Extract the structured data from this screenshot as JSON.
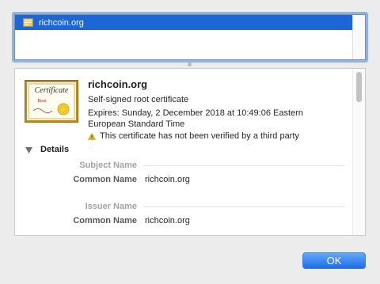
{
  "certificate_list": {
    "selected_item": "richcoin.org"
  },
  "summary": {
    "name": "richcoin.org",
    "type": "Self-signed root certificate",
    "expires": "Expires: Sunday, 2 December 2018 at 10:49:06 Eastern European Standard Time",
    "warning": "This certificate has not been verified by a third party",
    "certificate_image_text": "Certificate Root"
  },
  "details": {
    "label": "Details",
    "subject": {
      "header": "Subject Name",
      "common_name_label": "Common Name",
      "common_name_value": "richcoin.org"
    },
    "issuer": {
      "header": "Issuer Name",
      "common_name_label": "Common Name",
      "common_name_value": "richcoin.org"
    }
  },
  "buttons": {
    "ok": "OK"
  },
  "icons": {
    "list_row": "certificate-icon",
    "warning": "warning-triangle-icon",
    "details_toggle": "disclosure-triangle-icon"
  },
  "colors": {
    "selection": "#1c66d6",
    "focus_ring": "#8fb3e6",
    "button": "#1d6ee8",
    "warning": "#f2b731"
  }
}
